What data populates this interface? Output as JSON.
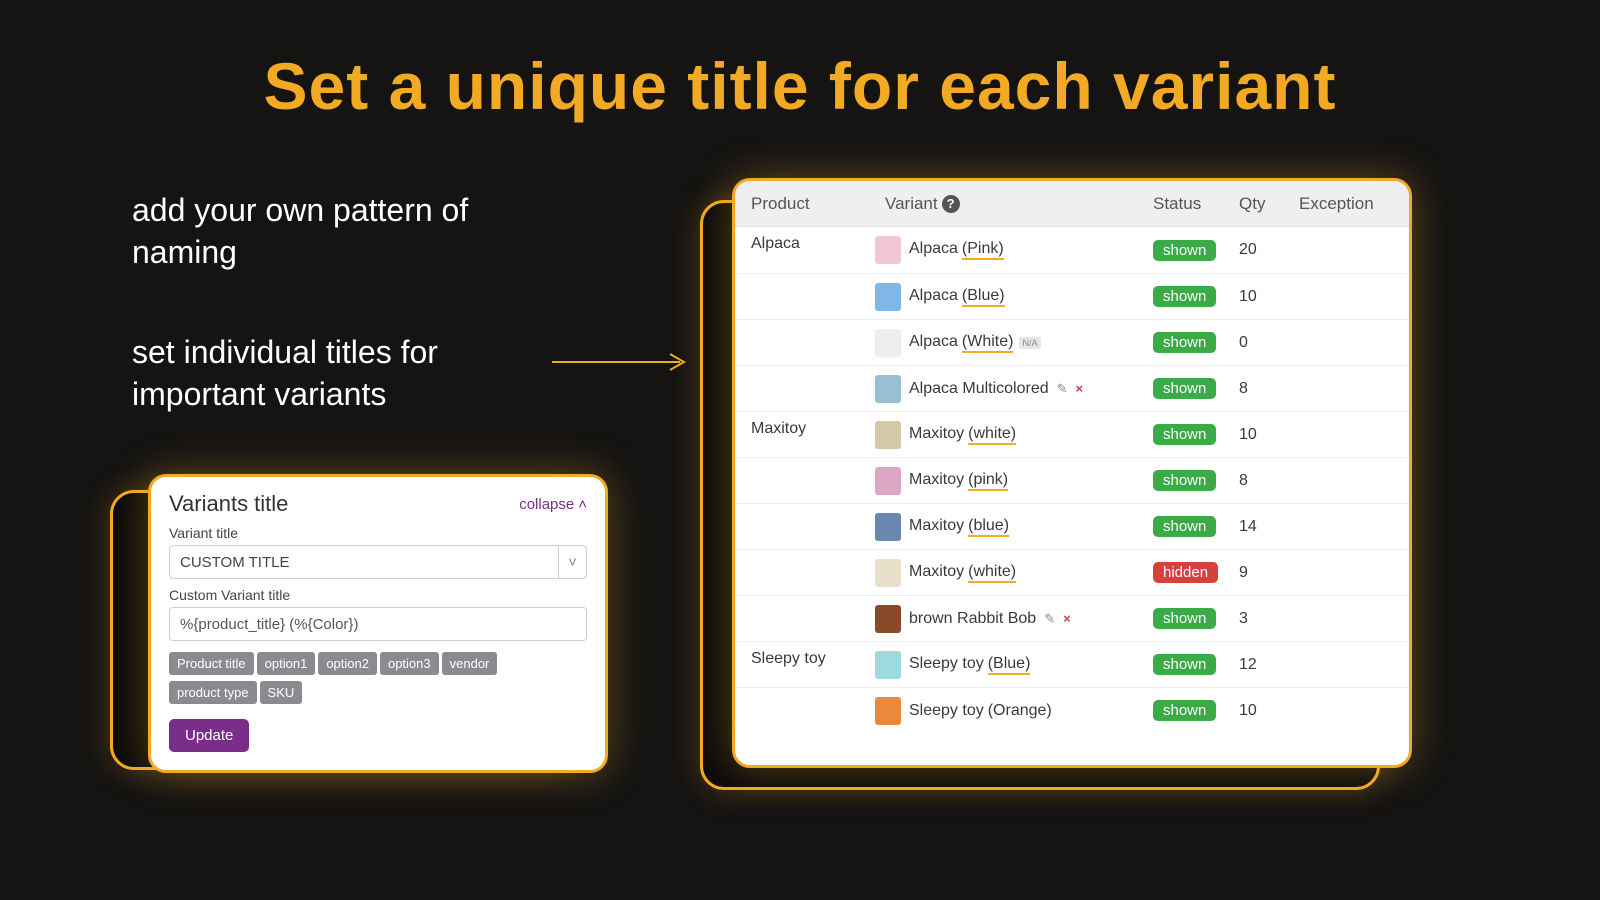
{
  "title": "Set a unique title for each variant",
  "desc1": "add your own pattern of naming",
  "desc2": "set individual titles for important variants",
  "left": {
    "heading": "Variants title",
    "collapse": "collapse",
    "label_variant_title": "Variant title",
    "select_value": "CUSTOM TITLE",
    "label_custom": "Custom Variant title",
    "input_value": "%{product_title} (%{Color})",
    "tags": [
      "Product title",
      "option1",
      "option2",
      "option3",
      "vendor",
      "product type",
      "SKU"
    ],
    "update": "Update"
  },
  "right": {
    "headers": {
      "product": "Product",
      "variant": "Variant",
      "status": "Status",
      "qty": "Qty",
      "exception": "Exception"
    },
    "help": "?",
    "groups": [
      {
        "product": "Alpaca",
        "rows": [
          {
            "variant_base": "Alpaca",
            "variant_paren": "(Pink)",
            "thumb": "#f3c6d6",
            "status": "shown",
            "qty": "20",
            "na": false,
            "editable": false
          },
          {
            "variant_base": "Alpaca",
            "variant_paren": "(Blue)",
            "thumb": "#7fb7e6",
            "status": "shown",
            "qty": "10",
            "na": false,
            "editable": false
          },
          {
            "variant_base": "Alpaca",
            "variant_paren": "(White)",
            "thumb": "#eeeeee",
            "status": "shown",
            "qty": "0",
            "na": true,
            "editable": false
          },
          {
            "variant_base": "Alpaca Multicolored",
            "variant_paren": "",
            "thumb": "#98c0d4",
            "status": "shown",
            "qty": "8",
            "na": false,
            "editable": true
          }
        ]
      },
      {
        "product": "Maxitoy",
        "rows": [
          {
            "variant_base": "Maxitoy",
            "variant_paren": "(white)",
            "thumb": "#d4c9a9",
            "status": "shown",
            "qty": "10",
            "na": false,
            "editable": false
          },
          {
            "variant_base": "Maxitoy",
            "variant_paren": "(pink)",
            "thumb": "#dca6c4",
            "status": "shown",
            "qty": "8",
            "na": false,
            "editable": false
          },
          {
            "variant_base": "Maxitoy",
            "variant_paren": "(blue)",
            "thumb": "#6a87b0",
            "status": "shown",
            "qty": "14",
            "na": false,
            "editable": false
          },
          {
            "variant_base": "Maxitoy",
            "variant_paren": "(white)",
            "thumb": "#e7dfc9",
            "status": "hidden",
            "qty": "9",
            "na": false,
            "editable": false
          },
          {
            "variant_base": "brown Rabbit Bob",
            "variant_paren": "",
            "thumb": "#8a4a2a",
            "status": "shown",
            "qty": "3",
            "na": false,
            "editable": true
          }
        ]
      },
      {
        "product": "Sleepy toy",
        "rows": [
          {
            "variant_base": "Sleepy toy",
            "variant_paren": "(Blue)",
            "thumb": "#9edbe0",
            "status": "shown",
            "qty": "12",
            "na": false,
            "editable": false
          },
          {
            "variant_base": "Sleepy toy",
            "variant_paren": "(Orange)",
            "thumb": "#e88a3a",
            "status": "shown",
            "qty": "10",
            "na": false,
            "editable": false,
            "no_underline": true
          }
        ]
      }
    ]
  }
}
